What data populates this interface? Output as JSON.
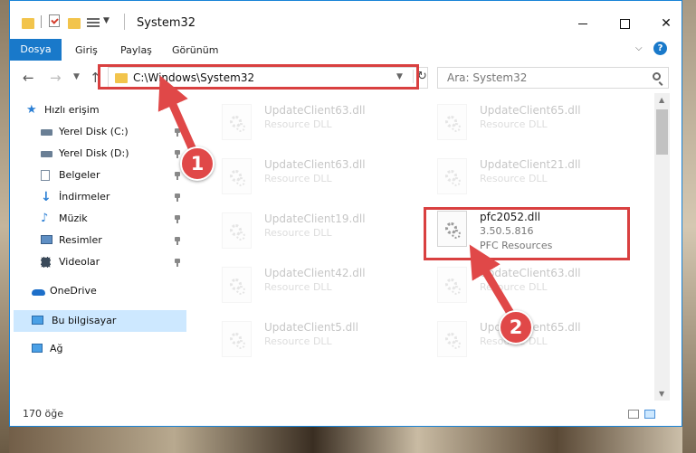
{
  "window": {
    "title": "System32"
  },
  "ribbon": {
    "tabs": [
      "Dosya",
      "Giriş",
      "Paylaş",
      "Görünüm"
    ]
  },
  "nav": {
    "path": "C:\\Windows\\System32",
    "search_placeholder": "Ara: System32"
  },
  "sidebar": {
    "items": [
      {
        "label": "Hızlı erişim",
        "icon": "star-icon"
      },
      {
        "label": "Yerel Disk (C:)",
        "icon": "drive-icon"
      },
      {
        "label": "Yerel Disk (D:)",
        "icon": "drive-icon"
      },
      {
        "label": "Belgeler",
        "icon": "documents-icon"
      },
      {
        "label": "İndirmeler",
        "icon": "download-icon"
      },
      {
        "label": "Müzik",
        "icon": "music-icon"
      },
      {
        "label": "Resimler",
        "icon": "pictures-icon"
      },
      {
        "label": "Videolar",
        "icon": "videos-icon"
      },
      {
        "label": "OneDrive",
        "icon": "cloud-icon"
      },
      {
        "label": "Bu bilgisayar",
        "icon": "computer-icon"
      },
      {
        "label": "Ağ",
        "icon": "network-icon"
      }
    ]
  },
  "files": [
    {
      "name": "UpdateClient63.dll",
      "type": "Resource DLL"
    },
    {
      "name": "UpdateClient65.dll",
      "type": "Resource DLL"
    },
    {
      "name": "UpdateClient63.dll",
      "type": "Resource DLL"
    },
    {
      "name": "UpdateClient21.dll",
      "type": "Resource DLL"
    },
    {
      "name": "UpdateClient19.dll",
      "type": "Resource DLL"
    },
    {
      "name": "pfc2052.dll",
      "version": "3.50.5.816",
      "type": "PFC Resources"
    },
    {
      "name": "UpdateClient42.dll",
      "type": "Resource DLL"
    },
    {
      "name": "UpdateClient63.dll",
      "type": "Resource DLL"
    },
    {
      "name": "UpdateClient5.dll",
      "type": "Resource DLL"
    },
    {
      "name": "UpdateClient65.dll",
      "type": "Resource DLL"
    }
  ],
  "status": {
    "count": "170 öğe"
  },
  "callouts": {
    "step1": "1",
    "step2": "2"
  },
  "colors": {
    "accent": "#1979ca",
    "highlight": "#d94040"
  }
}
